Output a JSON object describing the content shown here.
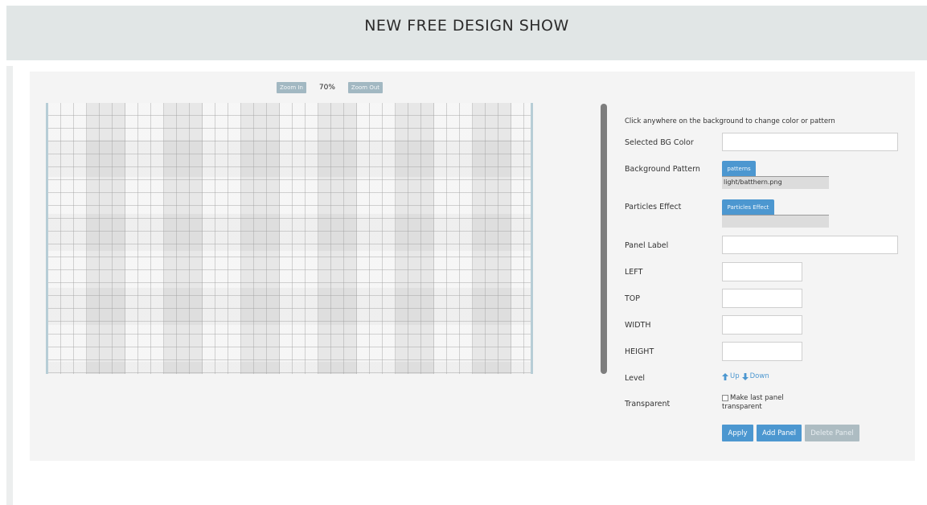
{
  "header": {
    "title": "NEW FREE DESIGN SHOW"
  },
  "zoom": {
    "zoom_in_label": "Zoom In",
    "level": "70%",
    "zoom_out_label": "Zoom Out"
  },
  "settings": {
    "instructions": "Click anywhere on the background to change color or pattern",
    "bg_color_label": "Selected BG Color",
    "bg_color_value": "",
    "bg_pattern_label": "Background Pattern",
    "patterns_button": "patterns",
    "pattern_value": "light/batthern.png",
    "particles_label": "Particles Effect",
    "particles_button": "Particles Effect",
    "particles_value": "",
    "panel_label_label": "Panel Label",
    "panel_label_value": "",
    "left_label": "LEFT",
    "left_value": "",
    "top_label": "TOP",
    "top_value": "",
    "width_label": "WIDTH",
    "width_value": "",
    "height_label": "HEIGHT",
    "height_value": "",
    "level_label": "Level",
    "up_label": "Up",
    "down_label": "Down",
    "transparent_label": "Transparent",
    "transparent_checkbox_label": "Make last panel transparent",
    "transparent_checked": false
  },
  "actions": {
    "apply": "Apply",
    "add_panel": "Add Panel",
    "delete_panel": "Delete Panel"
  },
  "icons": {
    "up": "arrow-up-icon",
    "down": "arrow-down-icon"
  },
  "colors": {
    "accent": "#4c97d0",
    "disabled": "#adbcc2",
    "header_bg": "#e1e6e6",
    "panel_bg": "#f4f4f4"
  }
}
